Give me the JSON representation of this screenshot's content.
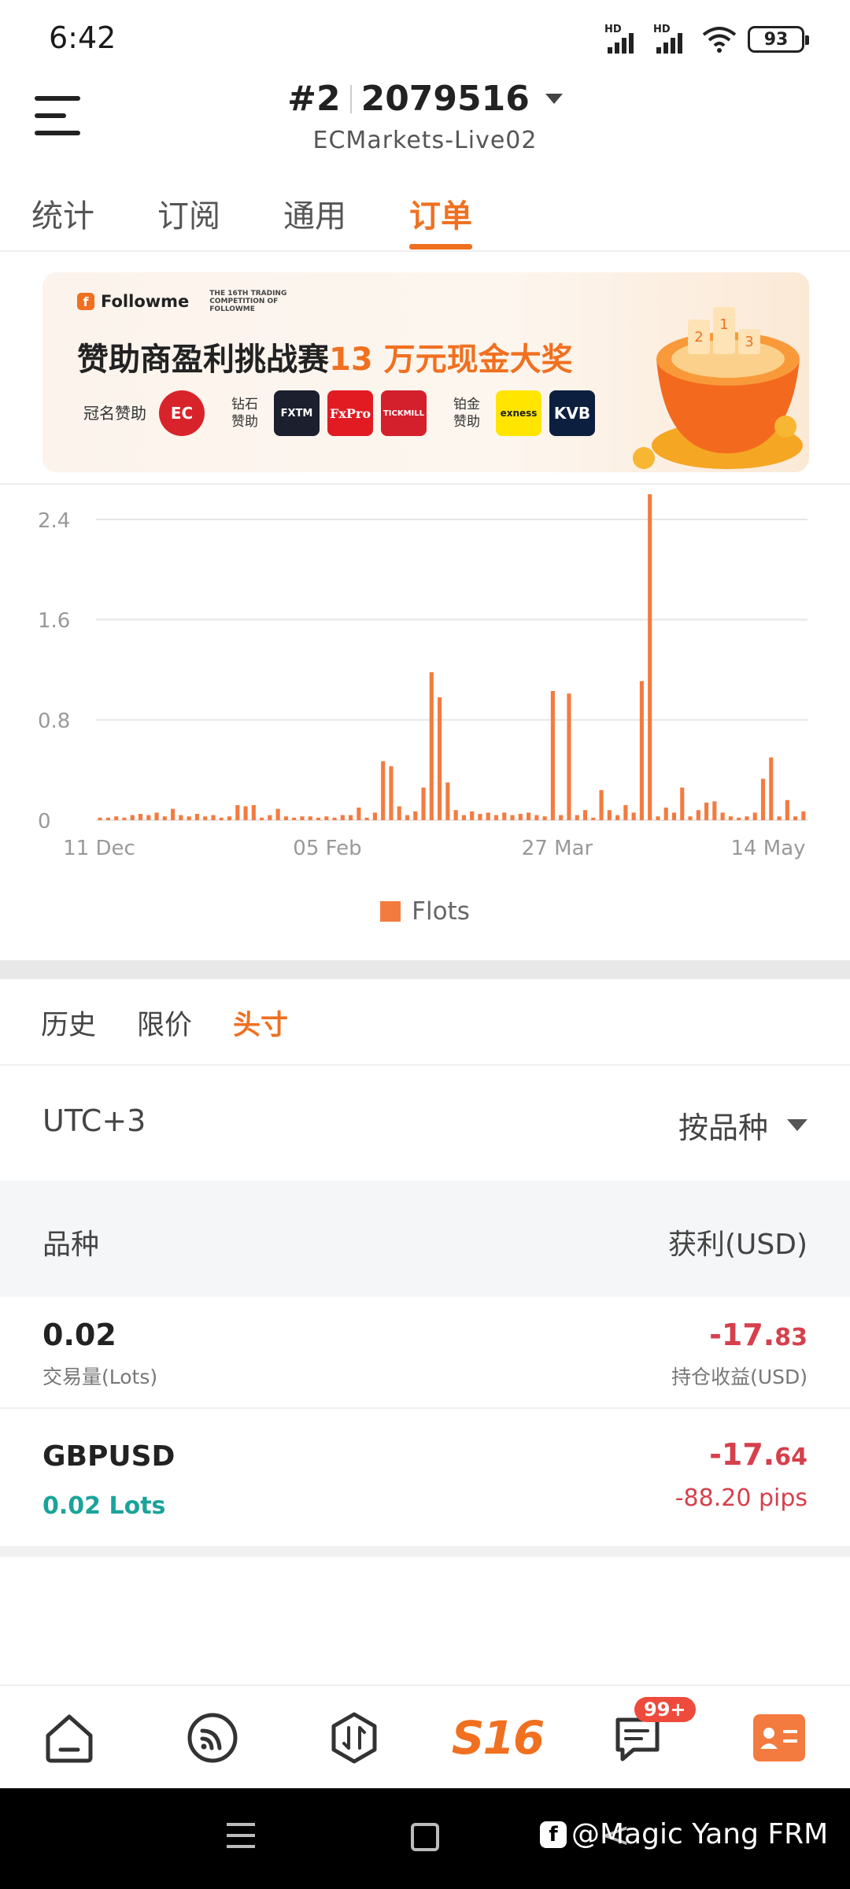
{
  "status": {
    "time": "6:42",
    "hd1": "HD",
    "hd2": "HD",
    "battery": "93"
  },
  "header": {
    "rank": "#2",
    "account_id": "2079516",
    "server": "ECMarkets-Live02"
  },
  "tabs": [
    {
      "label": "统计"
    },
    {
      "label": "订阅"
    },
    {
      "label": "通用"
    },
    {
      "label": "订单",
      "active": true
    }
  ],
  "banner": {
    "brand": "Followme",
    "competition": "THE 16TH TRADING COMPETITION OF FOLLOWME",
    "title_main": "赞助商盈利挑战赛",
    "title_highlight": "13 万元现金大奖",
    "title_sponsor_label": "冠名赞助",
    "diamond_label": "钻石赞助",
    "platinum_label": "铂金赞助",
    "sponsors": {
      "ec": "EC",
      "fxtm": "FXTM",
      "fxpro": "FxPro",
      "tickmill": "TICKMILL",
      "exness": "exness",
      "kvb": "KVB"
    },
    "trophy_digits": [
      "2",
      "1",
      "3"
    ]
  },
  "chart_data": {
    "type": "bar",
    "x_ticks": [
      "11 Dec",
      "05 Feb",
      "27 Mar",
      "14 May"
    ],
    "y_ticks": [
      "0",
      "0.8",
      "1.6",
      "2.4"
    ],
    "ylim": [
      0,
      2.6
    ],
    "grid": true,
    "legend": "bottom",
    "series": [
      {
        "name": "Flots",
        "color": "#f37b40",
        "values": [
          0.02,
          0.02,
          0.03,
          0.02,
          0.04,
          0.05,
          0.04,
          0.06,
          0.03,
          0.09,
          0.04,
          0.03,
          0.05,
          0.03,
          0.04,
          0.02,
          0.03,
          0.12,
          0.11,
          0.12,
          0.02,
          0.04,
          0.09,
          0.03,
          0.02,
          0.03,
          0.03,
          0.02,
          0.03,
          0.02,
          0.04,
          0.04,
          0.1,
          0.02,
          0.06,
          0.47,
          0.43,
          0.11,
          0.04,
          0.07,
          0.26,
          1.18,
          0.98,
          0.3,
          0.08,
          0.04,
          0.07,
          0.05,
          0.06,
          0.04,
          0.06,
          0.04,
          0.05,
          0.06,
          0.04,
          0.03,
          1.03,
          0.04,
          1.01,
          0.04,
          0.08,
          0.02,
          0.24,
          0.08,
          0.04,
          0.12,
          0.06,
          1.11,
          2.6,
          0.03,
          0.1,
          0.06,
          0.26,
          0.03,
          0.08,
          0.14,
          0.15,
          0.06,
          0.03,
          0.02,
          0.03,
          0.06,
          0.33,
          0.5,
          0.03,
          0.16,
          0.03,
          0.07
        ]
      }
    ]
  },
  "orders": {
    "subtabs": [
      {
        "label": "历史"
      },
      {
        "label": "限价"
      },
      {
        "label": "头寸",
        "active": true
      }
    ],
    "timezone": "UTC+3",
    "filter_label": "按品种",
    "col_symbol": "品种",
    "col_profit": "获利(USD)",
    "summary": {
      "volume": "0.02",
      "volume_label": "交易量(Lots)",
      "profit_int": "-17.",
      "profit_dec": "83",
      "profit_label": "持仓收益(USD)"
    },
    "positions": [
      {
        "symbol": "GBPUSD",
        "lots": "0.02 Lots",
        "profit_int": "-17.",
        "profit_dec": "64",
        "pips": "-88.20 pips"
      }
    ]
  },
  "bottom_nav": {
    "s16": "S16",
    "badge": "99+"
  },
  "watermark": "@Magic Yang FRM",
  "colors": {
    "accent": "#f07020",
    "loss": "#d6404c",
    "lots": "#1aa39a",
    "bar": "#f37b40"
  }
}
